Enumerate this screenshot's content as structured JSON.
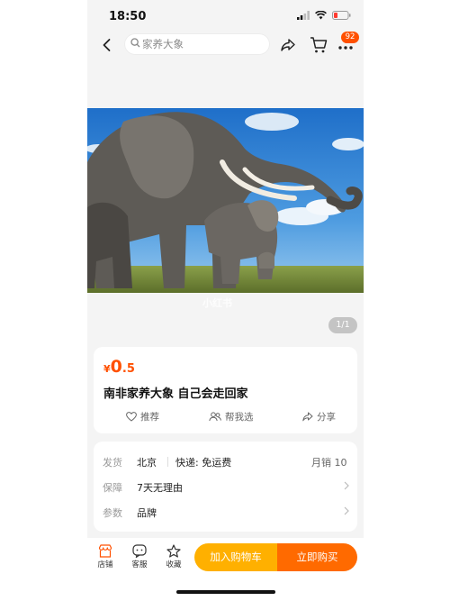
{
  "status": {
    "time": "18:50"
  },
  "search": {
    "placeholder": "家养大象"
  },
  "header": {
    "badge": "92"
  },
  "gallery": {
    "watermark": "小红书",
    "counter": "1/1"
  },
  "product": {
    "currency": "¥",
    "price_int": "0",
    "price_dec": ".5",
    "title": "南非家养大象 自己会走回家",
    "actions": [
      {
        "icon": "heart-icon",
        "label": "推荐"
      },
      {
        "icon": "people-icon",
        "label": "帮我选"
      },
      {
        "icon": "share-icon",
        "label": "分享"
      }
    ]
  },
  "details": {
    "ship_key": "发货",
    "ship_from": "北京",
    "ship_fee": "快递: 免运费",
    "monthly_sales": "月销 10",
    "guarantee_key": "保障",
    "guarantee_val": "7天无理由",
    "params_key": "参数",
    "params_val": "品牌"
  },
  "bottom": {
    "shop": "店铺",
    "service": "客服",
    "favorite": "收藏",
    "add_cart": "加入购物车",
    "buy_now": "立即购买"
  },
  "colors": {
    "accent": "#ff5000",
    "cart_btn": "#ffb000",
    "buy_btn": "#ff6a00"
  }
}
